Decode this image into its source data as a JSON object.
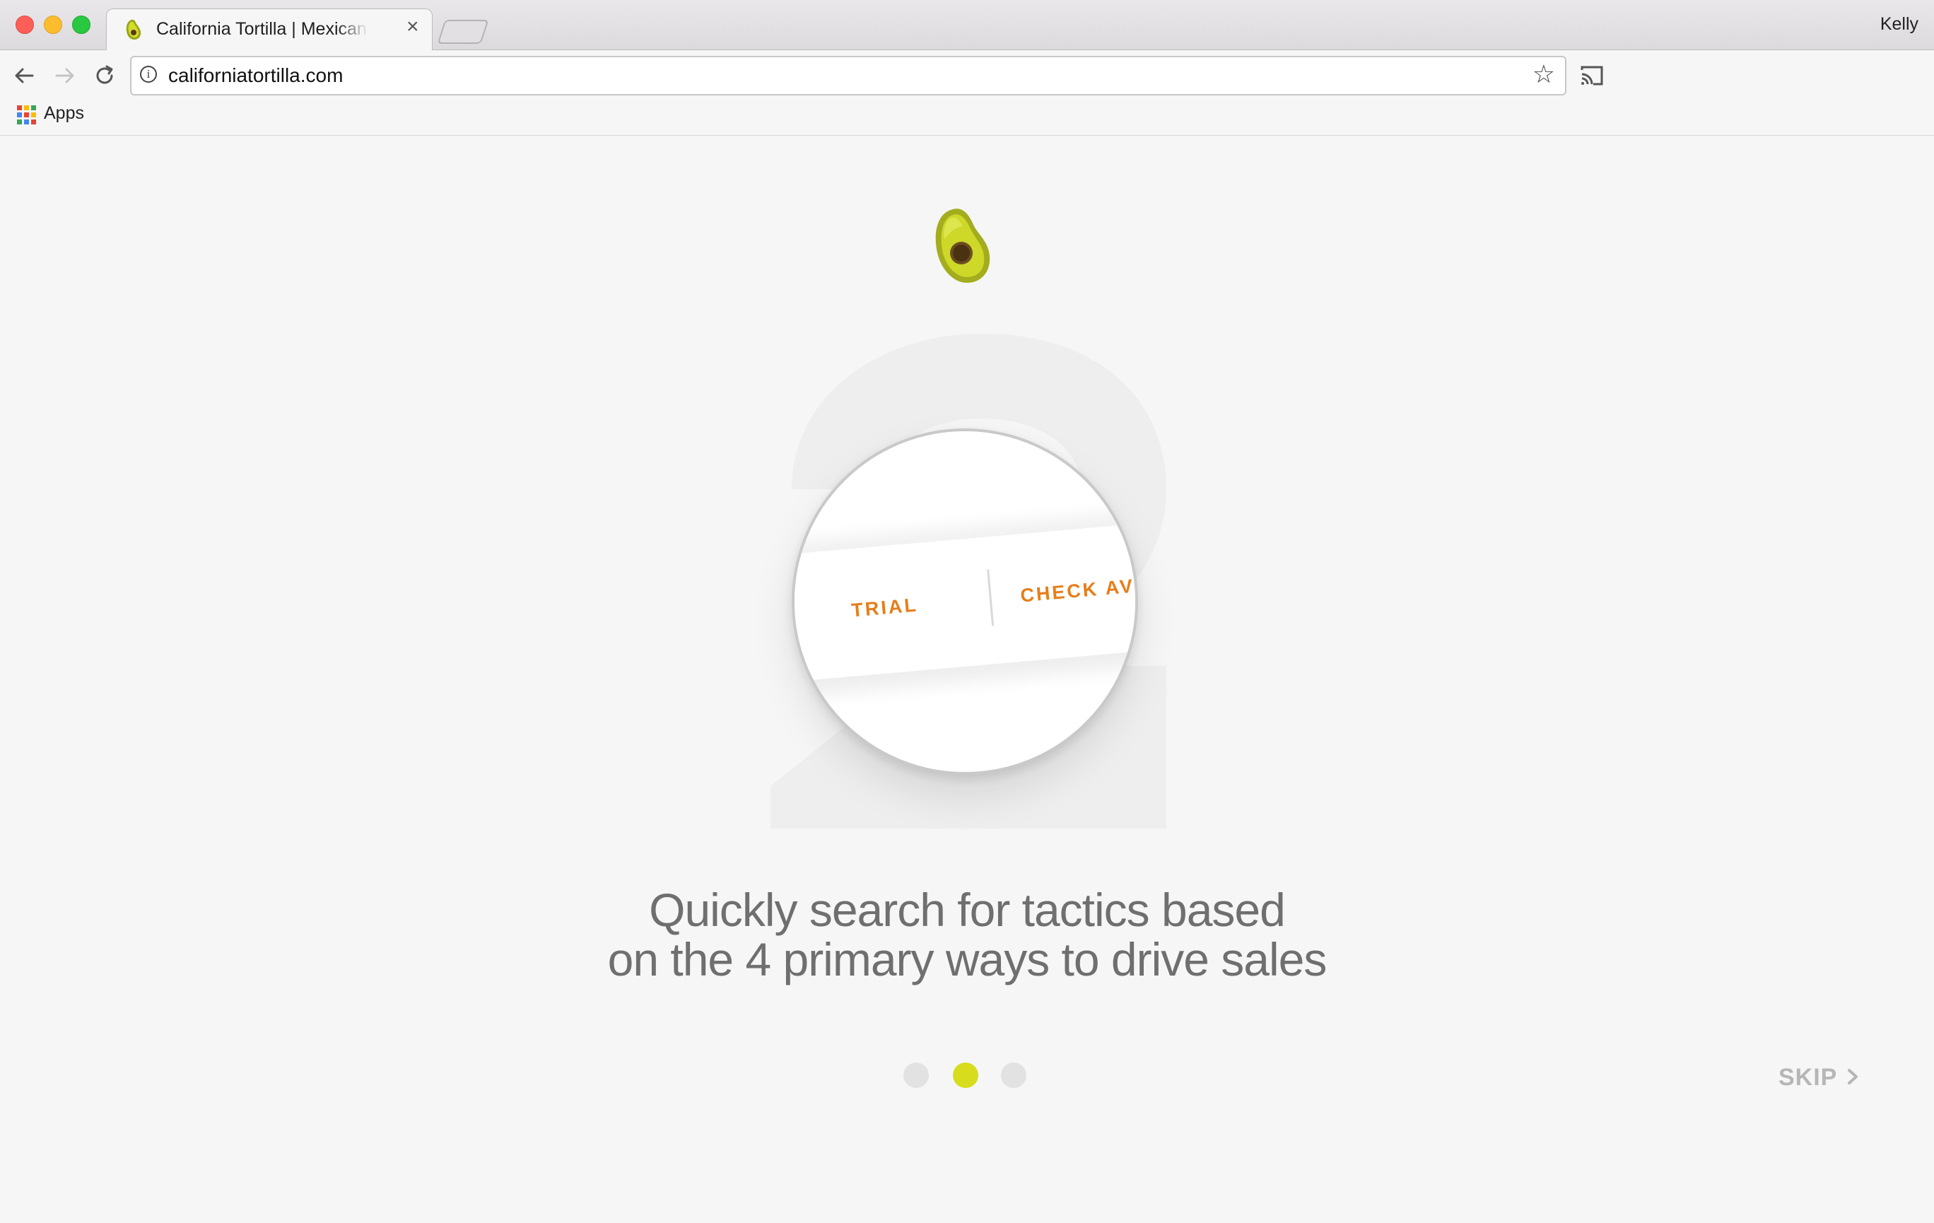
{
  "browser": {
    "tab": {
      "title": "California Tortilla | Mexican Fo",
      "close": "×",
      "favicon": "avocado-icon"
    },
    "profile_name": "Kelly",
    "address_bar": {
      "url": "californiatortilla.com",
      "info": "i"
    },
    "bookmark_bar": {
      "apps_label": "Apps"
    },
    "star": "☆"
  },
  "onboarding": {
    "logo": "avocado-logo",
    "step_numeral": "2",
    "lens_labels": {
      "first": "TRIAL",
      "second": "CHECK AVER"
    },
    "headline_line1": "Quickly search for tactics based",
    "headline_line2": "on the 4 primary ways to drive sales",
    "pager": {
      "total": 3,
      "active_index": 2
    },
    "skip_label": "SKIP"
  },
  "colors": {
    "accent_yellow": "#d7dc1c",
    "label_orange": "#e67e1a",
    "page_bg": "#f6f6f6",
    "headline": "#6f6f6f",
    "skip": "#b6b6b6"
  }
}
